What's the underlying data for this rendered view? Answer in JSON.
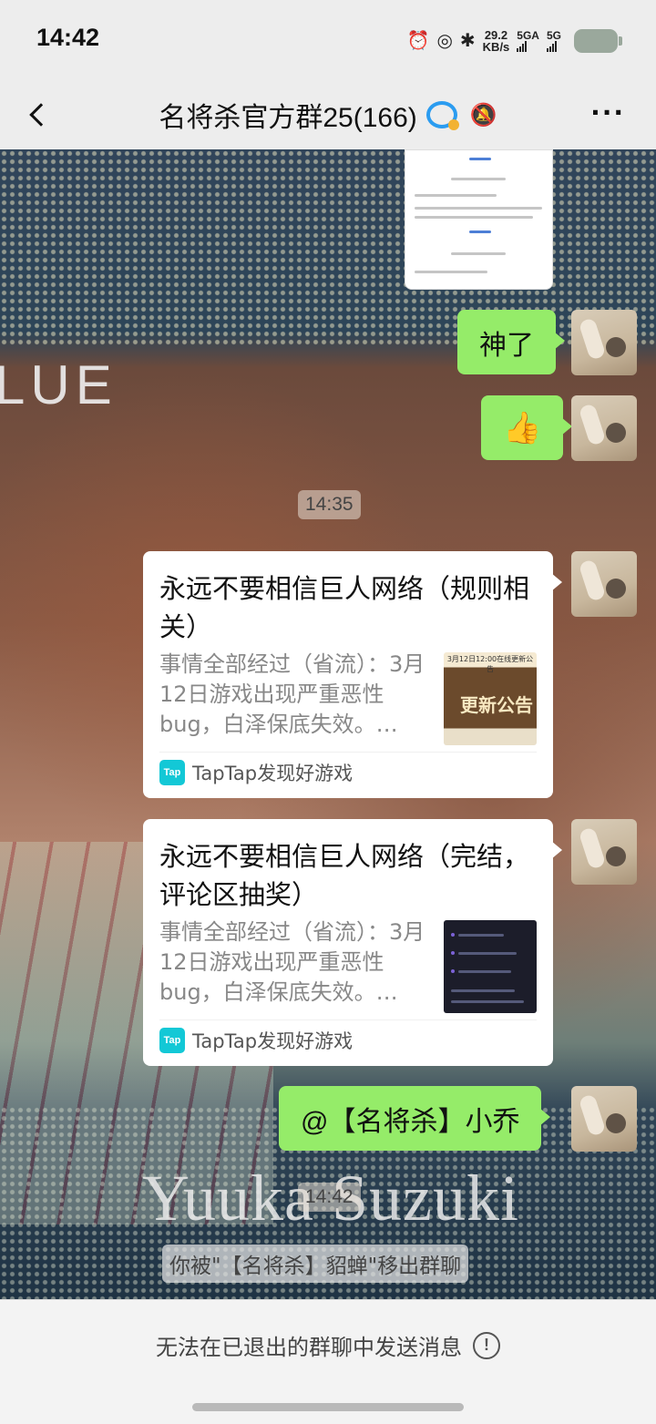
{
  "status_bar": {
    "time": "14:42",
    "net_speed_value": "29.2",
    "net_speed_unit": "KB/s",
    "sim1_label": "5GA",
    "sim2_label": "5G",
    "icons": [
      "alarm-icon",
      "eye-off-icon",
      "bluetooth-icon",
      "signal-icon",
      "battery-icon"
    ]
  },
  "header": {
    "title": "名将杀官方群25(166)",
    "back_icon": "chevron-left-icon",
    "more_label": "···"
  },
  "wallpaper": {
    "text_top": "LUE",
    "text_bottom": "Yuuka Suzuki"
  },
  "messages": {
    "m1": {
      "text": "神了",
      "sender": "self"
    },
    "m2": {
      "emoji": "👍",
      "sender": "self"
    },
    "time1": "14:35",
    "card1": {
      "title": "永远不要相信巨人网络（规则相关）",
      "desc": "事情全部经过（省流）：3月12日游戏出现严重恶性bug，白泽保底失效。…",
      "source": "TapTap发现好游戏",
      "source_logo": "Tap",
      "thumb_title": "3月12日12:00在线更新公告",
      "thumb_text": "更新公告"
    },
    "card2": {
      "title": "永远不要相信巨人网络（完结，评论区抽奖）",
      "desc": "事情全部经过（省流）：3月12日游戏出现严重恶性bug，白泽保底失效。…",
      "source": "TapTap发现好游戏",
      "source_logo": "Tap"
    },
    "m3": {
      "text": "@【名将杀】小乔",
      "sender": "self"
    },
    "time2": "14:42",
    "system": "你被\"【名将杀】貂蝉\"移出群聊"
  },
  "bottom": {
    "notice": "无法在已退出的群聊中发送消息",
    "info_icon": "!"
  },
  "colors": {
    "self_bubble": "#95ec69",
    "page_bg": "#ededed",
    "tap_brand": "#13c8d6"
  }
}
